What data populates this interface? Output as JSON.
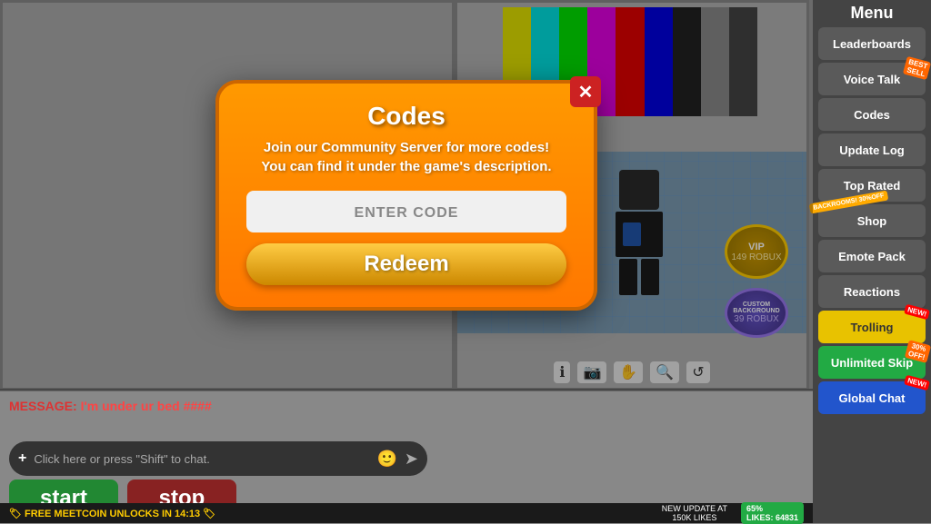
{
  "sidebar": {
    "title": "Menu",
    "buttons": [
      {
        "label": "Leaderboards",
        "id": "leaderboards",
        "badge": null,
        "style": "default"
      },
      {
        "label": "Voice Talk",
        "id": "voice-talk",
        "badge": "BEST SELL",
        "style": "default"
      },
      {
        "label": "Codes",
        "id": "codes",
        "badge": null,
        "style": "default"
      },
      {
        "label": "Update Log",
        "id": "update-log",
        "badge": null,
        "style": "default"
      },
      {
        "label": "Top Rated",
        "id": "top-rated",
        "badge": null,
        "style": "default"
      },
      {
        "label": "Shop",
        "id": "shop",
        "badge": "BACKROOMS! 30% OFF!",
        "style": "default"
      },
      {
        "label": "Emote Pack",
        "id": "emote-pack",
        "badge": null,
        "style": "default"
      },
      {
        "label": "Reactions",
        "id": "reactions",
        "badge": null,
        "style": "default"
      },
      {
        "label": "Trolling",
        "id": "trolling",
        "badge": "NEW!",
        "style": "yellow"
      },
      {
        "label": "Unlimited Skip",
        "id": "unlimited-skip",
        "badge": "30% OFF!",
        "style": "green"
      },
      {
        "label": "Global Chat",
        "id": "global-chat",
        "badge": "NEW!",
        "style": "blue"
      }
    ]
  },
  "modal": {
    "title": "Codes",
    "subtitle_line1": "Join our Community Server for more codes!",
    "subtitle_line2": "You can find it under the game's description.",
    "input_placeholder": "ENTER CODE",
    "redeem_label": "Redeem",
    "close_label": "✕"
  },
  "chat": {
    "message_label": "MESSAGE:",
    "message_text": "I'm under ur bed ####",
    "input_placeholder": "Click here or press \"Shift\" to chat.",
    "plus_symbol": "+"
  },
  "buttons": {
    "start_label": "start",
    "stop_label": "stop"
  },
  "status_bar": {
    "free_meetcoin": "🏷 FREE MEETCOIN UNLOCKS IN 14:13 🏷",
    "new_update": "NEW UPDATE AT\n150K LIKES",
    "likes_badge": "65%\nLIKES: 64831"
  },
  "vip": {
    "text": "VIP",
    "price": "149 ROBUX"
  },
  "custom_bg": {
    "text": "CUSTOM\nBACKGROUND",
    "price": "39 ROBUX"
  },
  "tv_colors": [
    "#f0f000",
    "#00f0f0",
    "#00f000",
    "#f000f0",
    "#f00000",
    "#0000f0",
    "#000000",
    "#888888",
    "#333333"
  ]
}
